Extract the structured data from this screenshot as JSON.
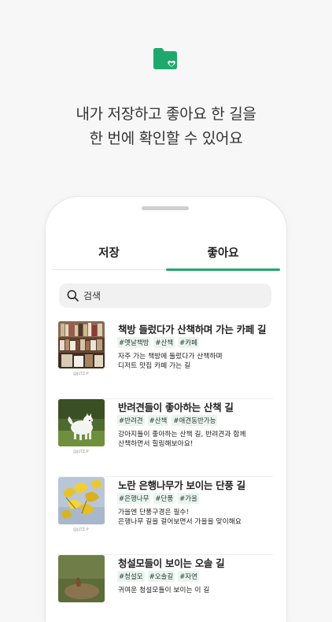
{
  "colors": {
    "accent": "#1fa86b",
    "tag_bg": "#e9f6ef"
  },
  "hero": {
    "icon": "folder-heart-icon",
    "line1": "내가 저장하고 좋아요 한 길을",
    "line2": "한 번에 확인할 수 있어요"
  },
  "tabs": [
    {
      "label": "저장",
      "selected": false
    },
    {
      "label": "좋아요",
      "selected": true
    }
  ],
  "search": {
    "placeholder": "검색",
    "icon": "search-icon"
  },
  "items": [
    {
      "title": "책방 들렀다가 산책하며 가는 카페 길",
      "tags": [
        "#옛날책방",
        "#산책",
        "#카페"
      ],
      "desc1": "자주 가는 책방에 들렀다가 산책하며",
      "desc2": "디저트 맛집 카페 가는 길",
      "credit": "@JLTZ.P"
    },
    {
      "title": "반려견들이 좋아하는 산책 길",
      "tags": [
        "#반려견",
        "#산책",
        "#애견동반가능"
      ],
      "desc1": "강아지들이 좋아하는 산책 길, 반려견과 함께",
      "desc2": "산책하면서 힐링해보아요!",
      "credit": "@JLTZ.P"
    },
    {
      "title": "노란 은행나무가 보이는 단풍 길",
      "tags": [
        "#은행나무",
        "#단풍",
        "#가을"
      ],
      "desc1": "가을엔 단풍구경은 필수!",
      "desc2": "은행나무 길을 걸어보면서 가을을 맞이해요",
      "credit": "@JLTZ.P"
    },
    {
      "title": "청설모들이 보이는 오솔 길",
      "tags": [
        "#청설모",
        "#오솔길",
        "#자연"
      ],
      "desc1": "귀여운 청설모들이 보이는 이 길",
      "desc2": "",
      "credit": ""
    }
  ]
}
